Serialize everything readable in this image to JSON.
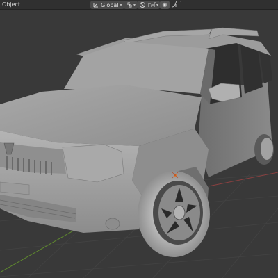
{
  "header": {
    "object_menu_label": "Object",
    "transform_orientation": "Global"
  },
  "icons": {
    "orientation": "orientation-axes-icon",
    "pivot": "pivot-point-icon",
    "snap": "snap-magnet-icon",
    "snap_target": "snap-target-icon",
    "proportional": "proportional-editing-icon",
    "falloff": "falloff-curve-icon"
  },
  "colors": {
    "header_bg": "#303030",
    "viewport_bg": "#393939",
    "grid_x_axis": "#8a4040",
    "grid_y_axis": "#5f8a2e",
    "model_gray": "#9a9a9a",
    "glass_dark": "#2e2e2e"
  }
}
